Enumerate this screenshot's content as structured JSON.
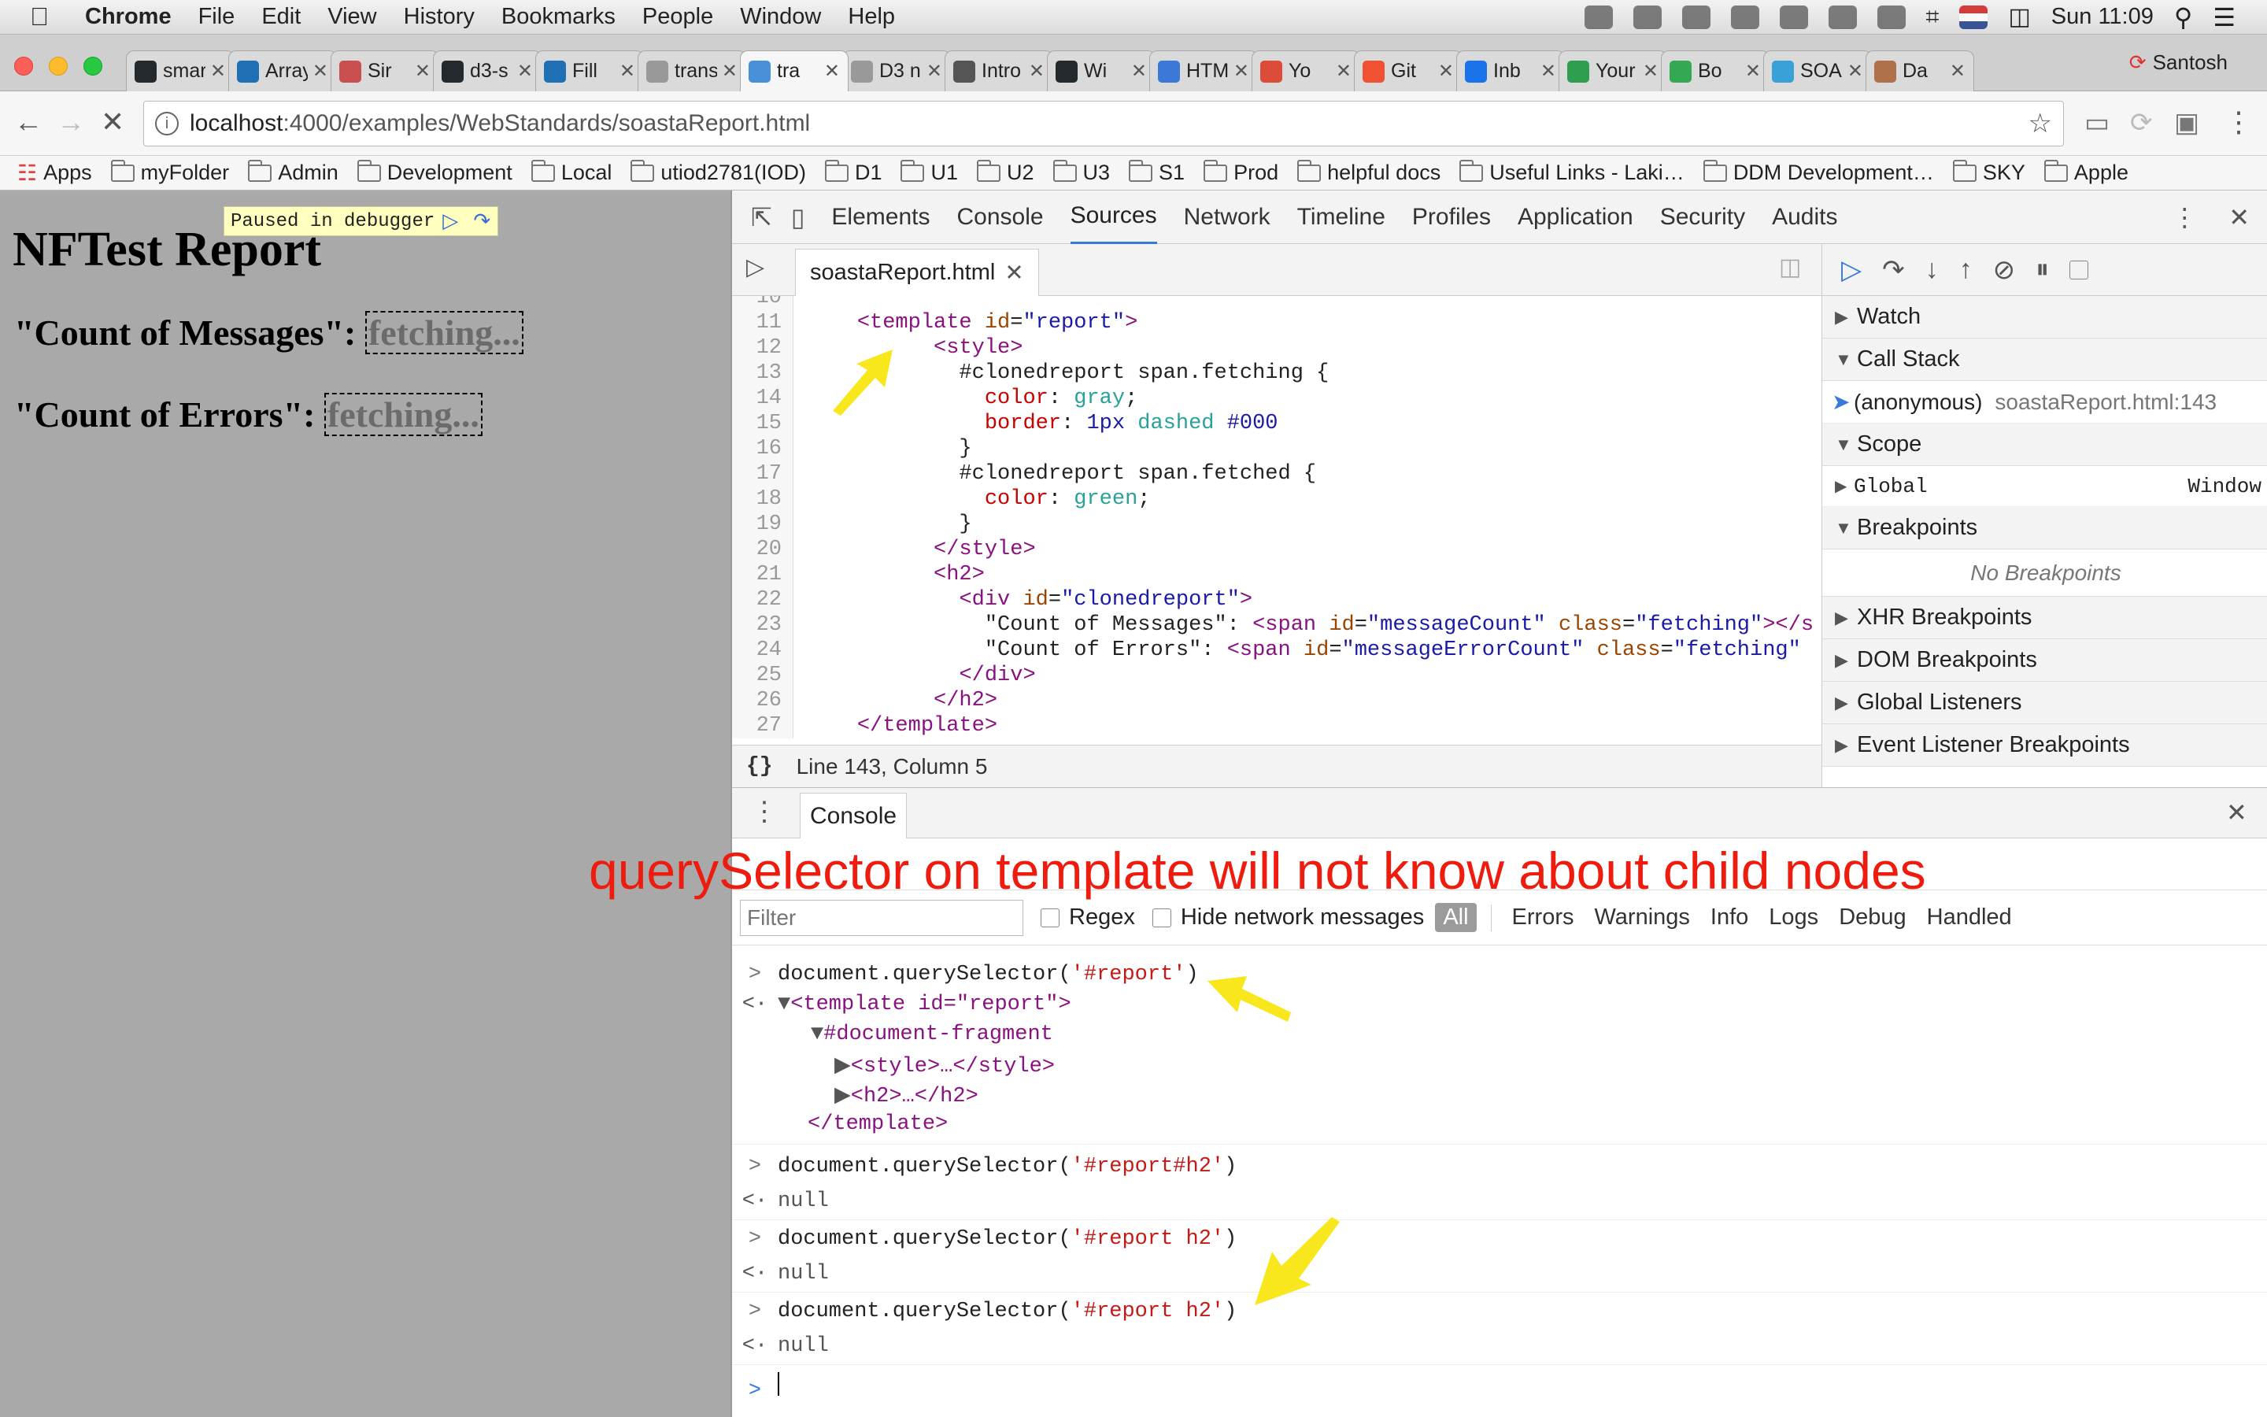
{
  "menubar": {
    "app": "Chrome",
    "items": [
      "File",
      "Edit",
      "View",
      "History",
      "Bookmarks",
      "People",
      "Window",
      "Help"
    ],
    "clock": "Sun 11:09"
  },
  "tabs": [
    {
      "label": "smar",
      "color": "#24292e"
    },
    {
      "label": "Array",
      "color": "#1f6fb4"
    },
    {
      "label": "Sir",
      "color": "#c95050"
    },
    {
      "label": "d3-s",
      "color": "#24292e"
    },
    {
      "label": "Fill",
      "color": "#1f6fb4"
    },
    {
      "label": "trans",
      "color": "#999999"
    },
    {
      "label": "tra",
      "color": "#4a90d9",
      "active": true
    },
    {
      "label": "D3 n",
      "color": "#999999"
    },
    {
      "label": "Intro",
      "color": "#555555"
    },
    {
      "label": "Wi",
      "color": "#24292e"
    },
    {
      "label": "HTMI",
      "color": "#3c78d8"
    },
    {
      "label": "Yo",
      "color": "#dd4b39"
    },
    {
      "label": "Git",
      "color": "#f05133"
    },
    {
      "label": "Inb",
      "color": "#1a73e8"
    },
    {
      "label": "Your",
      "color": "#2e9e4f"
    },
    {
      "label": "Bo",
      "color": "#34a853"
    },
    {
      "label": "SOAS",
      "color": "#3aa0d8"
    },
    {
      "label": "Da",
      "color": "#b0704a"
    }
  ],
  "profile": "Santosh",
  "address": {
    "host": "localhost",
    "path": ":4000/examples/WebStandards/soastaReport.html"
  },
  "bookmarks": [
    "Apps",
    "myFolder",
    "Admin",
    "Development",
    "Local",
    "utiod2781(IOD)",
    "D1",
    "U1",
    "U2",
    "U3",
    "S1",
    "Prod",
    "helpful docs",
    "Useful Links - Laki…",
    "DDM Development…",
    "SKY",
    "Apple"
  ],
  "page": {
    "title": "NFTest Report",
    "paused_label": "Paused in debugger",
    "messages_label": "\"Count of Messages\":",
    "errors_label": "\"Count of Errors\":",
    "fetching": "fetching..."
  },
  "devtools": {
    "tabs": [
      "Elements",
      "Console",
      "Sources",
      "Network",
      "Timeline",
      "Profiles",
      "Application",
      "Security",
      "Audits"
    ],
    "active_tab": "Sources",
    "file_tab": "soastaReport.html",
    "status": "Line 143, Column 5",
    "sidebar": {
      "watch": "Watch",
      "call_stack": "Call Stack",
      "frame_fn": "(anonymous)",
      "frame_loc": "soastaReport.html:143",
      "scope": "Scope",
      "global": "Global",
      "global_val": "Window",
      "breakpoints": "Breakpoints",
      "no_breakpoints": "No Breakpoints",
      "xhr": "XHR Breakpoints",
      "dom": "DOM Breakpoints",
      "listeners": "Global Listeners",
      "event": "Event Listener Breakpoints"
    }
  },
  "code_lines": [
    {
      "n": "10",
      "html": ""
    },
    {
      "n": "11",
      "html": "    <span class='tg'>&lt;template</span> <span class='at'>id</span>=<span class='av'>\"report\"</span><span class='tg'>&gt;</span>"
    },
    {
      "n": "12",
      "html": "          <span class='tg'>&lt;style&gt;</span>"
    },
    {
      "n": "13",
      "html": "            <span class='sel'>#clonedreport span.fetching {</span>"
    },
    {
      "n": "14",
      "html": "              <span class='pn'>color</span>: <span class='pv2'>gray</span>;"
    },
    {
      "n": "15",
      "html": "              <span class='pn'>border</span>: <span class='pv'>1px</span> <span class='pv2'>dashed</span> <span class='pv'>#000</span>"
    },
    {
      "n": "16",
      "html": "            }"
    },
    {
      "n": "17",
      "html": "            <span class='sel'>#clonedreport span.fetched {</span>"
    },
    {
      "n": "18",
      "html": "              <span class='pn'>color</span>: <span class='pv2'>green</span>;"
    },
    {
      "n": "19",
      "html": "            }"
    },
    {
      "n": "20",
      "html": "          <span class='tg'>&lt;/style&gt;</span>"
    },
    {
      "n": "21",
      "html": "          <span class='tg'>&lt;h2&gt;</span>"
    },
    {
      "n": "22",
      "html": "            <span class='tg'>&lt;div</span> <span class='at'>id</span>=<span class='av'>\"clonedreport\"</span><span class='tg'>&gt;</span>"
    },
    {
      "n": "23",
      "html": "              \"Count of Messages\": <span class='tg'>&lt;span</span> <span class='at'>id</span>=<span class='av'>\"messageCount\"</span> <span class='at'>class</span>=<span class='av'>\"fetching\"</span><span class='tg'>&gt;&lt;/s</span>"
    },
    {
      "n": "24",
      "html": "              \"Count of Errors\": <span class='tg'>&lt;span</span> <span class='at'>id</span>=<span class='av'>\"messageErrorCount\"</span> <span class='at'>class</span>=<span class='av'>\"fetching\"</span>"
    },
    {
      "n": "25",
      "html": "            <span class='tg'>&lt;/div&gt;</span>"
    },
    {
      "n": "26",
      "html": "          <span class='tg'>&lt;/h2&gt;</span>"
    },
    {
      "n": "27",
      "html": "    <span class='tg'>&lt;/template&gt;</span>"
    }
  ],
  "console": {
    "tab": "Console",
    "annotation": "querySelector on template will not know about child nodes",
    "filter_placeholder": "Filter",
    "regex": "Regex",
    "hide_network": "Hide network messages",
    "levels": [
      "All",
      "Errors",
      "Warnings",
      "Info",
      "Logs",
      "Debug",
      "Handled"
    ],
    "entries": [
      {
        "cmd": "document.querySelector(",
        "arg": "'#report'",
        "close": ")"
      },
      {
        "cmd": "document.querySelector(",
        "arg": "'#report#h2'",
        "close": ")",
        "result": "null"
      },
      {
        "cmd": "document.querySelector(",
        "arg": "'#report h2'",
        "close": ")",
        "result": "null"
      },
      {
        "cmd": "document.querySelector(",
        "arg": "'#report h2'",
        "close": ")",
        "result": "null"
      }
    ],
    "tree": {
      "open": "<template id=\"report\">",
      "fragment": "#document-fragment",
      "style": "<style>…</style>",
      "h2": "<h2>…</h2>",
      "close": "</template>"
    }
  },
  "colors": {
    "annotation": "#ee1c0e",
    "arrow": "#f8e71c",
    "accent": "#3879d9"
  }
}
